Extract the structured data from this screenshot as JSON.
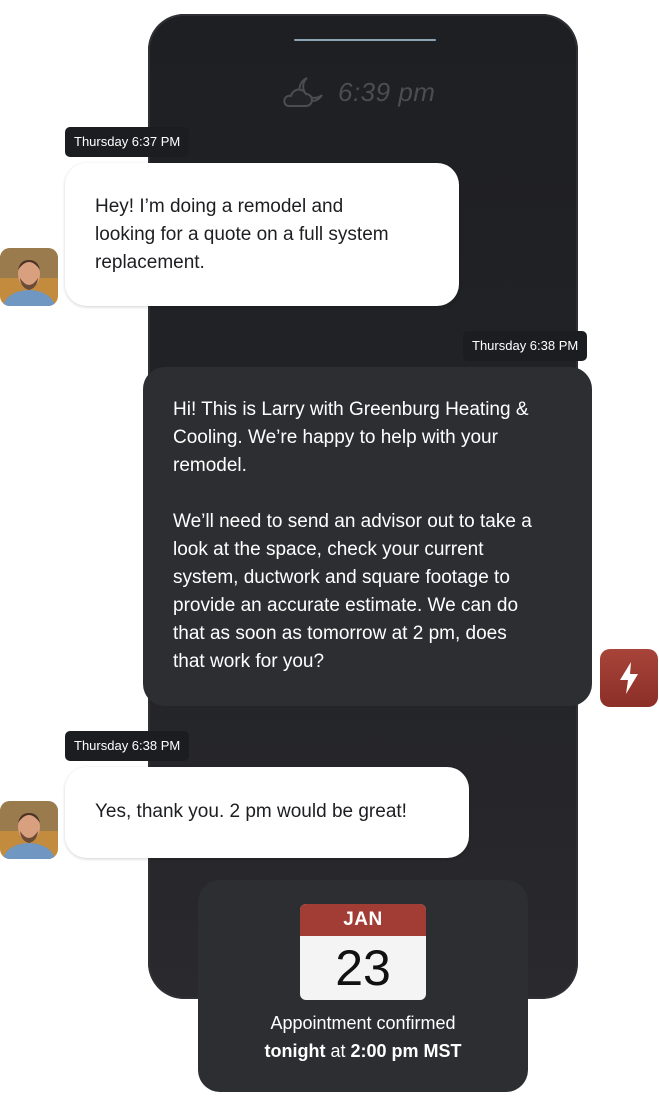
{
  "status": {
    "time": "6:39 pm",
    "weather_icon": "moon-cloud-icon"
  },
  "messages": [
    {
      "timestamp": "Thursday 6:37 PM",
      "text": "Hey! I’m doing a remodel and\nlooking for a quote on a full system\nreplacement.",
      "sender": "customer"
    },
    {
      "timestamp": "Thursday 6:38 PM",
      "text": "Hi! This is Larry with Greenburg Heating &\nCooling. We’re happy to help with your\nremodel.\n\nWe’ll need to send an advisor out to take a\nlook at the space, check your current\nsystem, ductwork and square footage to\nprovide an accurate estimate. We can do\nthat as soon as tomorrow at 2 pm, does\nthat work for you?",
      "sender": "business"
    },
    {
      "timestamp": "Thursday 6:38 PM",
      "text": "Yes, thank you. 2 pm would be great!",
      "sender": "customer"
    }
  ],
  "appointment": {
    "month": "JAN",
    "day": "23",
    "status": "Appointment confirmed",
    "when_bold": "tonight",
    "when_at": " at ",
    "time_bold": "2:00 pm MST"
  },
  "colors": {
    "accent": "#a23d35",
    "dark_bubble": "#2d2e32"
  },
  "icons": {
    "brand": "lightning-bolt-icon",
    "avatar": "customer-avatar"
  }
}
